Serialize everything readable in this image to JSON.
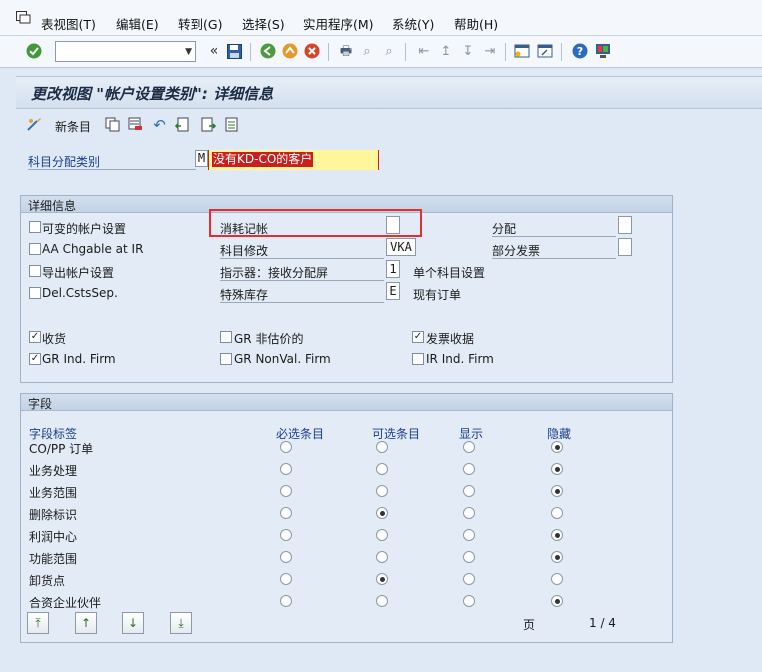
{
  "menubar": {
    "items": [
      "表视图(T)",
      "编辑(E)",
      "转到(G)",
      "选择(S)",
      "实用程序(M)",
      "系统(Y)",
      "帮助(H)"
    ]
  },
  "toolbar": {
    "command_value": "",
    "icons": [
      "enter-check",
      "save",
      "back",
      "exit",
      "cancel",
      "print",
      "find",
      "find-next",
      "first-page",
      "prev-page",
      "next-page",
      "last-page",
      "create-session",
      "shortcut",
      "help",
      "customize"
    ]
  },
  "title": "更改视图 \"帐户设置类别\": 详细信息",
  "app_toolbar": {
    "new_entries": "新条目"
  },
  "key_field": {
    "label": "科目分配类别",
    "code": "M",
    "description": "没有KD-CO的客户"
  },
  "details": {
    "header": "详细信息",
    "rows": [
      {
        "check": "可变的帐户设置",
        "checked": false,
        "field": "消耗记帐",
        "value": "",
        "right_label": "分配",
        "right_value": ""
      },
      {
        "check": "AA Chgable at IR",
        "checked": false,
        "field": "科目修改",
        "value": "VKA",
        "right_label": "部分发票",
        "right_value": ""
      },
      {
        "check": "导出帐户设置",
        "checked": false,
        "field": "指示器：接收分配屏",
        "value": "1",
        "right_label": "单个科目设置"
      },
      {
        "check": "Del.CstsSep.",
        "checked": false,
        "field": "特殊库存",
        "value": "E",
        "right_label": "现有订单"
      }
    ],
    "flags": [
      {
        "label": "收货",
        "checked": true
      },
      {
        "label": "GR 非估价的",
        "checked": false
      },
      {
        "label": "发票收据",
        "checked": true
      },
      {
        "label": "GR Ind. Firm",
        "checked": true
      },
      {
        "label": "GR NonVal. Firm",
        "checked": false
      },
      {
        "label": "IR Ind. Firm",
        "checked": false
      }
    ]
  },
  "fields": {
    "header": "字段",
    "columns": [
      "字段标签",
      "必选条目",
      "可选条目",
      "显示",
      "隐藏"
    ],
    "rows": [
      {
        "label": "CO/PP 订单",
        "selected": 3
      },
      {
        "label": "业务处理",
        "selected": 3
      },
      {
        "label": "业务范围",
        "selected": 3
      },
      {
        "label": "删除标识",
        "selected": 1
      },
      {
        "label": "利润中心",
        "selected": 3
      },
      {
        "label": "功能范围",
        "selected": 3
      },
      {
        "label": "卸货点",
        "selected": 1
      },
      {
        "label": "合资企业伙伴",
        "selected": 3
      }
    ],
    "page_label": "页",
    "page_value": "1 / 4"
  },
  "colors": {
    "background": "#dfe9f5",
    "highlight_box": "#e03030",
    "key_desc_bg": "#c9201f",
    "key_field_bg": "#fff59a"
  }
}
